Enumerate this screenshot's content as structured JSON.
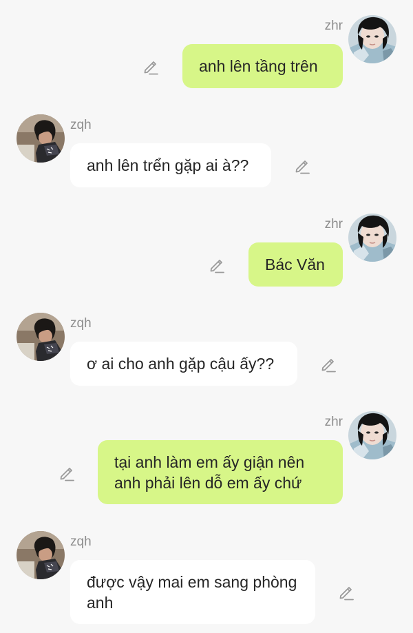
{
  "messages": [
    {
      "sender": "zhr",
      "text": "anh lên tầng trên",
      "side": "right",
      "avatar_icon": "user-photo-icon"
    },
    {
      "sender": "zqh",
      "text": "anh lên trển gặp ai à??",
      "side": "left",
      "avatar_icon": "user-photo-icon"
    },
    {
      "sender": "zhr",
      "text": "Bác Văn",
      "side": "right",
      "avatar_icon": "user-photo-icon"
    },
    {
      "sender": "zqh",
      "text": "ơ ai cho anh gặp cậu ấy??",
      "side": "left",
      "avatar_icon": "user-photo-icon"
    },
    {
      "sender": "zhr",
      "text": "tại anh làm em ấy giận nên anh phải lên dỗ em ấy chứ",
      "side": "right",
      "avatar_icon": "user-photo-icon"
    },
    {
      "sender": "zqh",
      "text": "được vậy mai em sang phòng anh",
      "side": "left",
      "avatar_icon": "user-photo-icon"
    }
  ],
  "colors": {
    "background": "#f7f7f7",
    "bubble_self": "#d7f688",
    "bubble_other": "#ffffff",
    "name_text": "#8e8e8e",
    "edit_icon": "#9a9a9a"
  },
  "icons": {
    "edit": "pencil-icon"
  }
}
